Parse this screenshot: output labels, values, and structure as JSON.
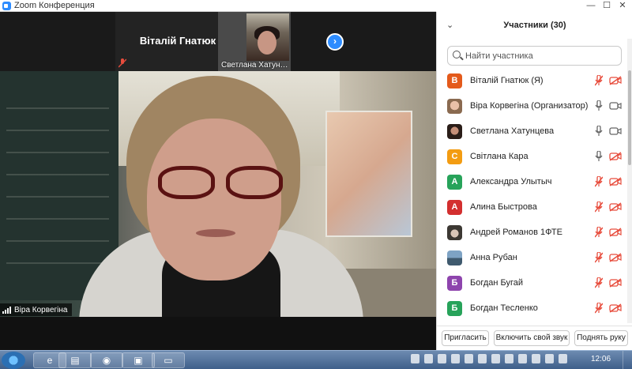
{
  "window": {
    "title": "Zoom Конференция",
    "controls": [
      "—",
      "☐",
      "✕"
    ],
    "panel_controls": [
      "—",
      "☐",
      "✕"
    ]
  },
  "thumbnails": [
    {
      "name": "Віталій Гнатюк",
      "video": false,
      "muted": true
    },
    {
      "name": "Светлана Хатун…",
      "video": true
    }
  ],
  "next_page_icon": "chevron-right-icon",
  "active_speaker": {
    "name": "Віра Корвегіна"
  },
  "participants_panel": {
    "title": "Участники (30)",
    "search_placeholder": "Найти участника",
    "participants": [
      {
        "name": "Віталій Гнатюк (Я)",
        "initial": "В",
        "color": "#e45a1b",
        "mic": "off",
        "video": "off"
      },
      {
        "name": "Віра Корвегіна (Организатор)",
        "initial": "",
        "color": "photo1",
        "mic": "on",
        "video": "on"
      },
      {
        "name": "Светлана Хатунцева",
        "initial": "",
        "color": "photo2",
        "mic": "on",
        "video": "on"
      },
      {
        "name": "Світлана Кара",
        "initial": "С",
        "color": "#f39c12",
        "mic": "on",
        "video": "off"
      },
      {
        "name": "Александра Улытыч",
        "initial": "А",
        "color": "#27a35a",
        "mic": "off",
        "video": "off"
      },
      {
        "name": "Алина Быстрова",
        "initial": "А",
        "color": "#d32f2f",
        "mic": "off",
        "video": "off"
      },
      {
        "name": "Андрей Романов 1ФТЕ",
        "initial": "",
        "color": "photo3",
        "mic": "off",
        "video": "off"
      },
      {
        "name": "Анна Рубан",
        "initial": "",
        "color": "photo4",
        "mic": "off",
        "video": "off"
      },
      {
        "name": "Богдан Бугай",
        "initial": "Б",
        "color": "#8e44ad",
        "mic": "off",
        "video": "off"
      },
      {
        "name": "Богдан Тесленко",
        "initial": "Б",
        "color": "#27a35a",
        "mic": "off",
        "video": "off"
      }
    ],
    "buttons": {
      "invite": "Пригласить",
      "unmute": "Включить свой звук",
      "raise_hand": "Поднять руку"
    }
  },
  "taskbar": {
    "apps": [
      "ie-icon",
      "folder-icon",
      "chrome-icon",
      "terminal-icon",
      "zoom-icon"
    ],
    "clock": "12:06"
  }
}
